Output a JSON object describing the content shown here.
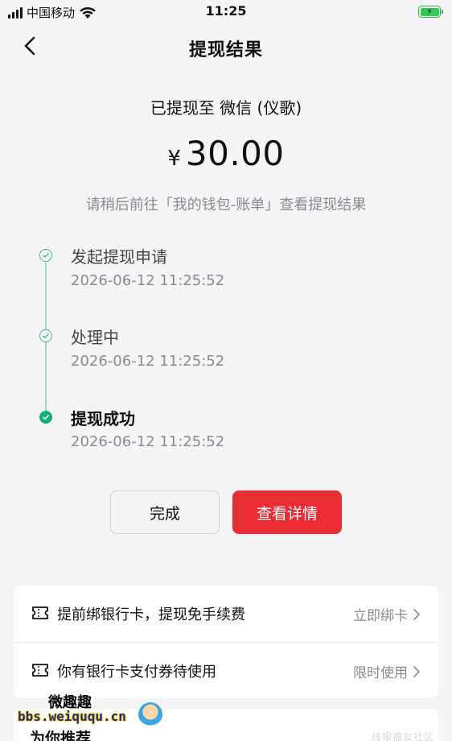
{
  "status_bar": {
    "carrier": "中国移动",
    "time": "11:25"
  },
  "header": {
    "title": "提现结果"
  },
  "result": {
    "destination": "已提现至 微信 (仪歌)",
    "currency": "¥",
    "amount": "30.00",
    "hint": "请稍后前往「我的钱包-账单」查看提现结果"
  },
  "timeline": [
    {
      "title": "发起提现申请",
      "time": "2026-06-12 11:25:52",
      "state": "passed"
    },
    {
      "title": "处理中",
      "time": "2026-06-12 11:25:52",
      "state": "passed"
    },
    {
      "title": "提现成功",
      "time": "2026-06-12 11:25:52",
      "state": "current"
    }
  ],
  "buttons": {
    "done": "完成",
    "detail": "查看详情"
  },
  "promo": [
    {
      "text": "提前绑银行卡，提现免手续费",
      "action": "立即绑卡"
    },
    {
      "text": "你有银行卡支付券待使用",
      "action": "限时使用"
    }
  ],
  "recommend": {
    "title": "为你推荐"
  },
  "watermark": {
    "name": "微趣趣",
    "url": "bbs.weiququ.cn",
    "right": "线报福友社区"
  },
  "colors": {
    "accent_red": "#ea2c35",
    "success_green": "#0fae7b",
    "battery_green": "#34c759"
  }
}
